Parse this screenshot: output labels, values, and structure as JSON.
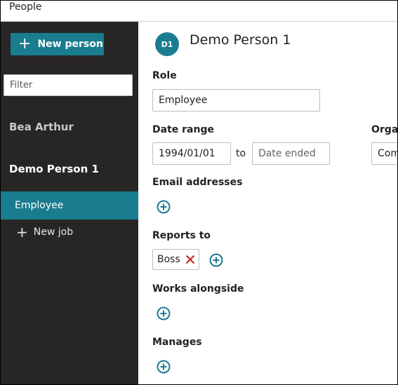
{
  "app": {
    "title": "People"
  },
  "sidebar": {
    "new_person_label": "New person",
    "filter_placeholder": "Filter",
    "people": [
      "Bea Arthur",
      "Demo Person 1"
    ],
    "jobs": {
      "selected": "Employee",
      "new_job_label": "New job"
    }
  },
  "person": {
    "initials": "D1",
    "name": "Demo Person 1",
    "role_label": "Role",
    "role_value": "Employee",
    "date_range_label": "Date range",
    "date_start": "1994/01/01",
    "to_label": "to",
    "date_end_placeholder": "Date ended",
    "organisation_label": "Organ",
    "organisation_value": "Com",
    "email_label": "Email addresses",
    "reports_to_label": "Reports to",
    "reports_to_tag": "Boss",
    "works_alongside_label": "Works alongside",
    "manages_label": "Manages"
  },
  "colors": {
    "accent": "#1a7c8f",
    "sidebar_bg": "#272625",
    "remove": "#c62828"
  }
}
